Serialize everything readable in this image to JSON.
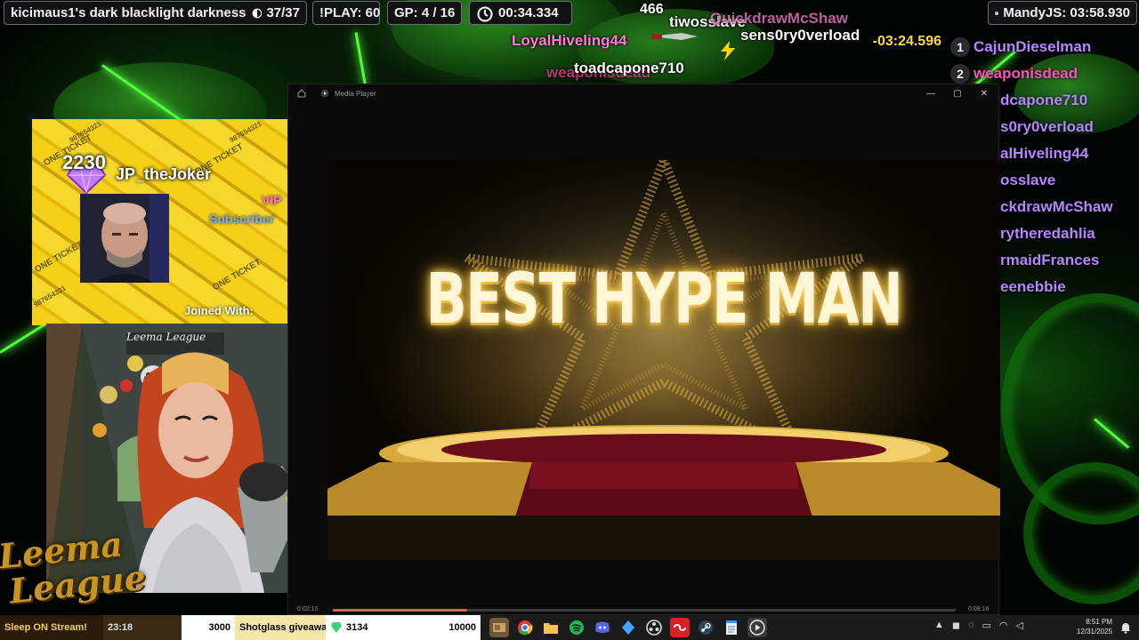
{
  "hud": {
    "run_title": "kicimaus1's dark blacklight darkness",
    "run_progress": "37/37",
    "play_count": "!PLAY: 60",
    "gp": "GP: 4 / 16",
    "timer": "00:34.334",
    "leader": "MandyJS: 03:58.930",
    "split_diff": "-03:24.596"
  },
  "floaters": [
    {
      "text": "466",
      "color": "#ffffff"
    },
    {
      "text": "LoyalHiveling44",
      "color": "#ff7ad9"
    },
    {
      "text": "tiwosslave",
      "color": "#ffffff"
    },
    {
      "text": "QuickdrawMcShaw",
      "color": "#ff7ad9"
    },
    {
      "text": "sens0ry0verload",
      "color": "#ffffff"
    },
    {
      "text": "weaponisdead",
      "color": "#ff3aa0"
    },
    {
      "text": "toadcapone710",
      "color": "#ffffff"
    }
  ],
  "leaderboard": [
    {
      "rank": "1",
      "name": "CajunDieselman",
      "color": "#b784ff"
    },
    {
      "rank": "2",
      "name": "weaponisdead",
      "color": "#ff4fc0"
    },
    {
      "rank": "",
      "name": "dcapone710",
      "color": "#b784ff"
    },
    {
      "rank": "",
      "name": "s0ry0verload",
      "color": "#b784ff"
    },
    {
      "rank": "",
      "name": "alHiveling44",
      "color": "#b784ff"
    },
    {
      "rank": "",
      "name": "osslave",
      "color": "#b784ff"
    },
    {
      "rank": "",
      "name": "ckdrawMcShaw",
      "color": "#b784ff"
    },
    {
      "rank": "",
      "name": "rytheredahlia",
      "color": "#b784ff"
    },
    {
      "rank": "",
      "name": "rmaidFrances",
      "color": "#b784ff"
    },
    {
      "rank": "",
      "name": "eenebbie",
      "color": "#b784ff"
    }
  ],
  "media_player": {
    "title": "Media Player",
    "headline": "BEST HYPE MAN",
    "time_elapsed": "0:02:10",
    "time_total": "0:08:16",
    "progress_fraction": 0.215,
    "controls": {
      "minimize": "—",
      "maximize": "▢",
      "close": "✕"
    }
  },
  "alert": {
    "score": "2230",
    "username": "JP_theJoker",
    "vip_label": "VIP",
    "sub_label": "Subscriber",
    "joined_label": "Joined With:",
    "ticket_text": "ONE TICKET",
    "ticket_number": "987654321"
  },
  "webcam": {
    "sign_text": "Leema League",
    "logo_line1": "Leema",
    "logo_line2": "League"
  },
  "ticker": {
    "seg1": "Sleep ON Stream!",
    "seg2": "23:18",
    "seg3": "3000",
    "seg4": "Shotglass giveaway",
    "seg5": "3134",
    "seg6": "10000"
  },
  "taskbar": {
    "icons": [
      "files-icon",
      "chrome-icon",
      "folder-icon",
      "spotify-icon",
      "discord-icon",
      "app-icon",
      "obs-icon",
      "creative-cloud-icon",
      "steam-icon",
      "notepad-icon",
      "media-player-icon"
    ],
    "clock_time": "8:51 PM",
    "clock_date": "12/31/2025"
  },
  "colors": {
    "laser": "#4dff3a",
    "accent_gold": "#ffd86b",
    "pink": "#ff7ad9",
    "purple": "#b784ff"
  }
}
